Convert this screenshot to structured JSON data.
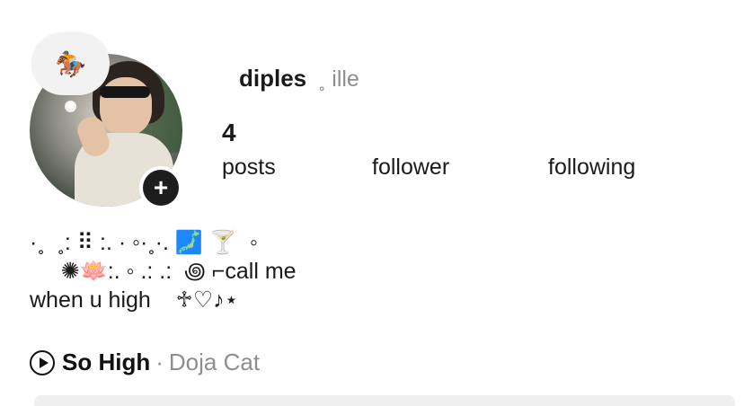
{
  "profile": {
    "note_emoji": "🏇",
    "username": "diples",
    "username_suffix": "˳ ille",
    "add_icon": "+",
    "stats": [
      {
        "value": "4",
        "label": "posts"
      },
      {
        "value": "",
        "label": "follower"
      },
      {
        "value": "",
        "label": "following"
      }
    ],
    "bio": "·˳  ˳: ⠿ :. · ◦·˳·. 🗾 🍸  ◦\n     ✺🪷:. ◦ .: .:  ꩜ ⌐call me\nwhen u high    ♱♡♪⋆"
  },
  "music": {
    "icon": "play-circle-icon",
    "song": "So High",
    "separator": "·",
    "artist": "Doja Cat"
  }
}
